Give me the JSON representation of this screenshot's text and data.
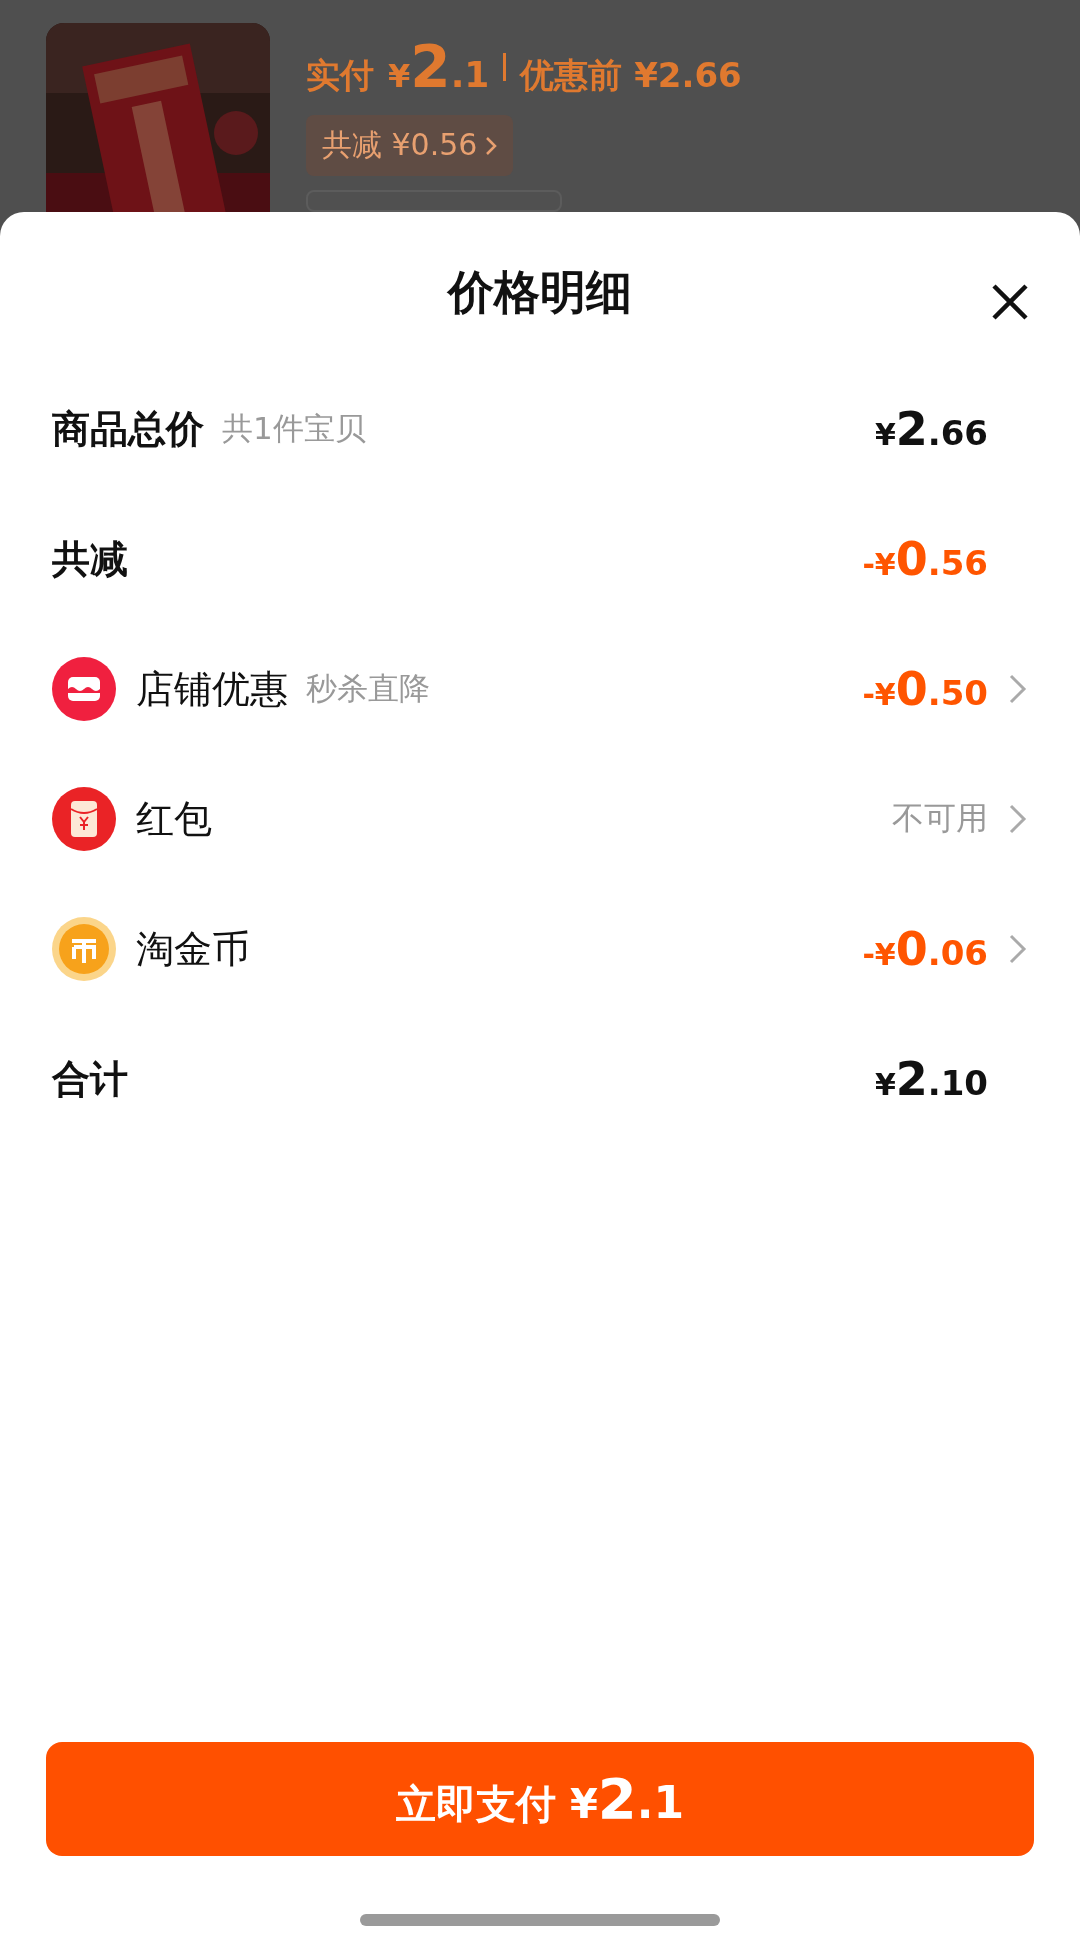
{
  "background": {
    "paid_label": "实付",
    "paid_amount": "¥2.1",
    "original_price": "优惠前 ¥2.66",
    "discount_chip": "共减 ¥0.56"
  },
  "sheet": {
    "title": "价格明细",
    "rows": [
      {
        "kind": "subtotal",
        "label": "商品总价",
        "note": "共1件宝贝",
        "amount": "¥2.66",
        "available": true,
        "has_arrow": false
      },
      {
        "kind": "deduction",
        "label": "共减",
        "amount": "-¥0.56",
        "available": true,
        "has_arrow": false
      },
      {
        "kind": "store",
        "label": "店铺优惠",
        "note": "秒杀直降",
        "amount": "-¥0.50",
        "available": true,
        "has_arrow": true
      },
      {
        "kind": "red_packet",
        "label": "红包",
        "amount": "不可用",
        "available": false,
        "has_arrow": true
      },
      {
        "kind": "coin",
        "label": "淘金币",
        "amount": "-¥0.06",
        "available": true,
        "has_arrow": true
      },
      {
        "kind": "total",
        "label": "合计",
        "amount": "¥2.10",
        "available": true,
        "has_arrow": false
      }
    ],
    "pay_button": "立即支付 ¥2.1"
  }
}
